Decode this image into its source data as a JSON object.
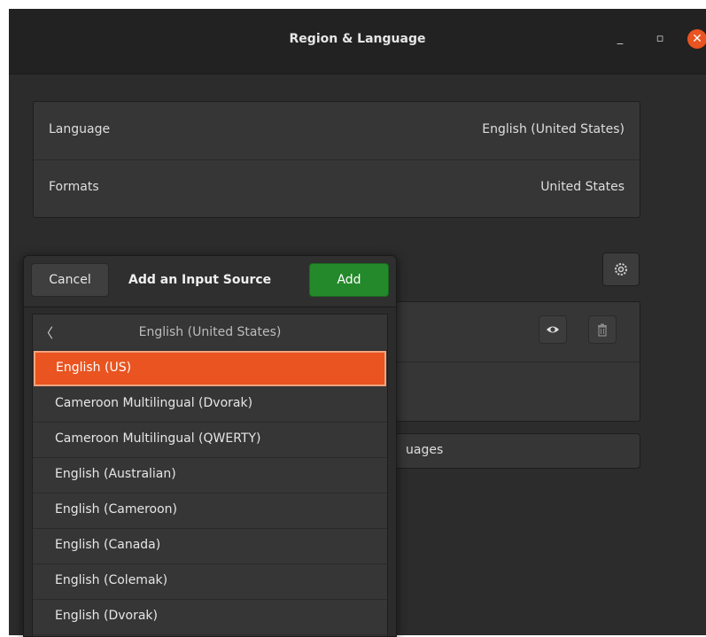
{
  "window": {
    "title": "Region & Language",
    "controls": {
      "minimize": "_",
      "maximize": "▫",
      "close": "✕"
    }
  },
  "settings": {
    "language_label": "Language",
    "language_value": "English (United States)",
    "formats_label": "Formats",
    "formats_value": "United States",
    "manage_label_partial": "uages"
  },
  "dialog": {
    "cancel_label": "Cancel",
    "title": "Add an Input Source",
    "add_label": "Add",
    "list_header": "English (United States)",
    "back_symbol": "〈",
    "items": [
      "English (US)",
      "Cameroon Multilingual (Dvorak)",
      "Cameroon Multilingual (QWERTY)",
      "English (Australian)",
      "English (Cameroon)",
      "English (Canada)",
      "English (Colemak)",
      "English (Dvorak)"
    ],
    "selected_index": 0
  },
  "colors": {
    "accent": "#e95420",
    "add_button": "#24892b",
    "window_bg": "#2c2c2c"
  },
  "icons": [
    "gear-icon",
    "eye-icon",
    "trash-icon",
    "close-icon",
    "minimize-icon",
    "maximize-icon",
    "back-arrow-icon"
  ]
}
